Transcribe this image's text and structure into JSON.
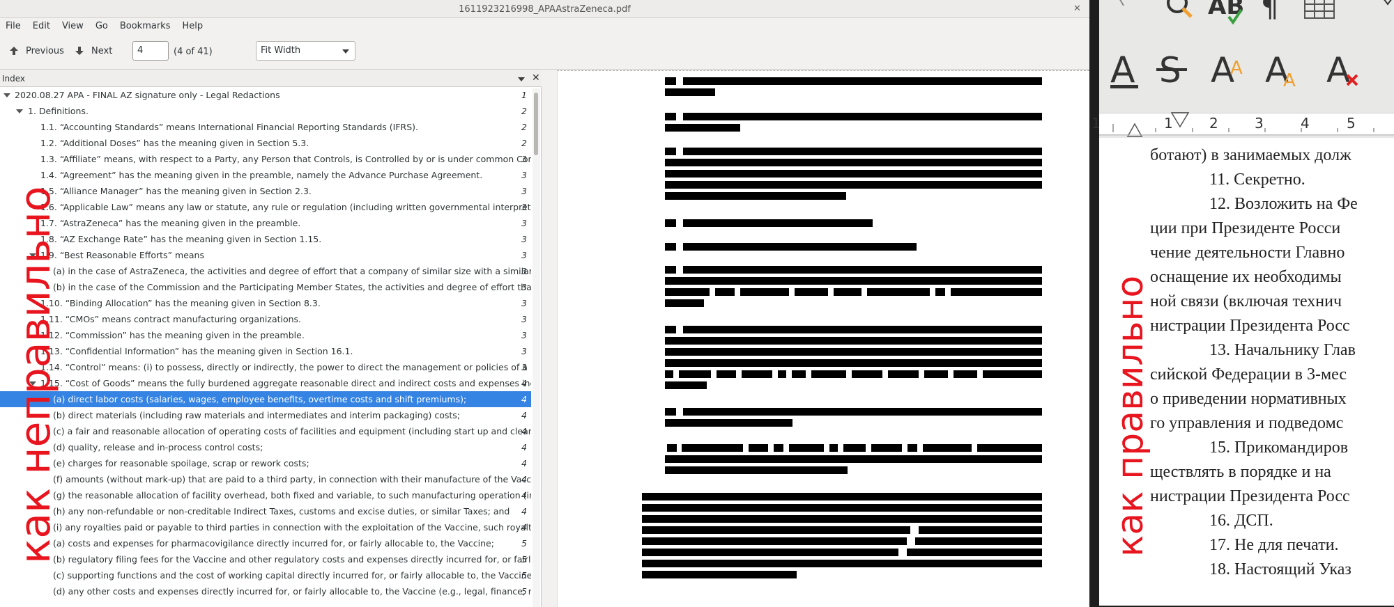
{
  "viewer": {
    "window_title": "1611923216998_APAAstraZeneca.pdf",
    "menu": [
      "File",
      "Edit",
      "View",
      "Go",
      "Bookmarks",
      "Help"
    ],
    "toolbar": {
      "previous_label": "Previous",
      "next_label": "Next",
      "page_value": "4",
      "page_count": "(4 of 41)",
      "zoom_value": "Fit Width"
    },
    "index": {
      "header": "Index",
      "rows": [
        {
          "label": "2020.08.27 APA - FINAL AZ signature only - Legal Redactions",
          "page": "1"
        },
        {
          "label": "1. Definitions.",
          "page": "2"
        },
        {
          "label": "1.1. “Accounting Standards” means International Financial Reporting Standards (IFRS).",
          "page": "2"
        },
        {
          "label": "1.2. “Additional Doses” has the meaning given in Section 5.3.",
          "page": "2"
        },
        {
          "label": "1.3. “Affiliate” means, with respect to a Party, any Person that Controls, is Controlled by or is under common Control...",
          "page": "3"
        },
        {
          "label": "1.4. “Agreement” has the meaning given in the preamble, namely the Advance Purchase Agreement.",
          "page": "3"
        },
        {
          "label": "1.5. “Alliance Manager” has the meaning given in Section 2.3.",
          "page": "3"
        },
        {
          "label": "1.6. “Applicable Law” means any law or statute, any rule or regulation (including written governmental interpretatio...",
          "page": "3"
        },
        {
          "label": "1.7. “AstraZeneca” has the meaning given in the preamble.",
          "page": "3"
        },
        {
          "label": "1.8. “AZ Exchange Rate” has the meaning given in Section 1.15.",
          "page": "3"
        },
        {
          "label": "1.9. “Best Reasonable Efforts” means",
          "page": "3"
        },
        {
          "label": "(a) in the case of AstraZeneca, the activities and degree of effort that a company of similar size with a similarly-size...",
          "page": "3"
        },
        {
          "label": "(b) in the case of the Commission and the Participating Member States, the activities and degree of effort that gove...",
          "page": "3"
        },
        {
          "label": "1.10. “Binding Allocation” has the meaning given in Section 8.3.",
          "page": "3"
        },
        {
          "label": "1.11. “CMOs” means contract manufacturing organizations.",
          "page": "3"
        },
        {
          "label": "1.12. “Commission” has the meaning given in the preamble.",
          "page": "3"
        },
        {
          "label": "1.13. “Confidential Information” has the meaning given in Section 16.1.",
          "page": "3"
        },
        {
          "label": "1.14. “Control” means: (i) to possess, directly or indirectly, the power to direct the management or policies of a Pers...",
          "page": "3"
        },
        {
          "label": "1.15. “Cost of Goods” means the fully burdened aggregate reasonable direct and indirect costs and expenses incur...",
          "page": "4"
        },
        {
          "label": "(a) direct labor costs (salaries, wages, employee benefits, overtime costs and shift premiums);",
          "page": "4"
        },
        {
          "label": "(b) direct materials (including raw materials and intermediates and interim packaging) costs;",
          "page": "4"
        },
        {
          "label": "(c) a fair and reasonable allocation of operating costs of facilities and equipment (including start up and cleaning c...",
          "page": "4"
        },
        {
          "label": "(d) quality, release and in-process control costs;",
          "page": "4"
        },
        {
          "label": "(e) charges for reasonable spoilage, scrap or rework costs;",
          "page": "4"
        },
        {
          "label": "(f) amounts (without mark-up) that are paid to a third party, in connection with their manufacture of the Vaccine or ...",
          "page": "4"
        },
        {
          "label": "(g) the reasonable allocation of facility overhead, both fixed and variable, to such manufacturing operation (includi...",
          "page": "4"
        },
        {
          "label": "(h) any non-refundable or non-creditable Indirect Taxes, customs and excise duties, or similar Taxes; and",
          "page": "4"
        },
        {
          "label": "(i) any royalties paid or payable to third parties in connection with the exploitation of the Vaccine, such royalties to ...",
          "page": "4"
        },
        {
          "label": "(a) costs and expenses for pharmacovigilance directly incurred for, or fairly allocable to, the Vaccine;",
          "page": "5"
        },
        {
          "label": "(b) regulatory filing fees for the Vaccine and other regulatory costs and expenses directly incurred for, or fairly allo...",
          "page": "5"
        },
        {
          "label": "(c) supporting functions and the cost of working capital directly incurred for, or fairly allocable to, the Vaccine; and",
          "page": "5"
        },
        {
          "label": "(d) any other costs and expenses directly incurred for, or fairly allocable to, the Vaccine (e.g., legal, finance, reporti...",
          "page": "5"
        }
      ]
    }
  },
  "captions": {
    "left": "как неправильно",
    "right": "как правильно",
    "color": "#e8141e"
  },
  "writer": {
    "ruler_numbers": [
      "1",
      "1",
      "2",
      "3",
      "4",
      "5"
    ],
    "lines": [
      "ботают) в занимаемых долж",
      "11. Секретно.",
      "12. Возложить на Фе",
      "ции при Президенте Росси",
      "чение деятельности Главно",
      "оснащение их необходимы",
      "ной связи (включая технич",
      "нистрации Президента Росс",
      "13. Начальнику Глав",
      "сийской Федерации в 3-мес",
      "о приведении нормативных",
      "го управления и подведомс",
      "15. Прикомандиров",
      "ществлять в порядке и на",
      "нистрации Президента Росс",
      "16. ДСП.",
      "17. Не для печати.",
      "18. Настоящий Указ"
    ]
  }
}
